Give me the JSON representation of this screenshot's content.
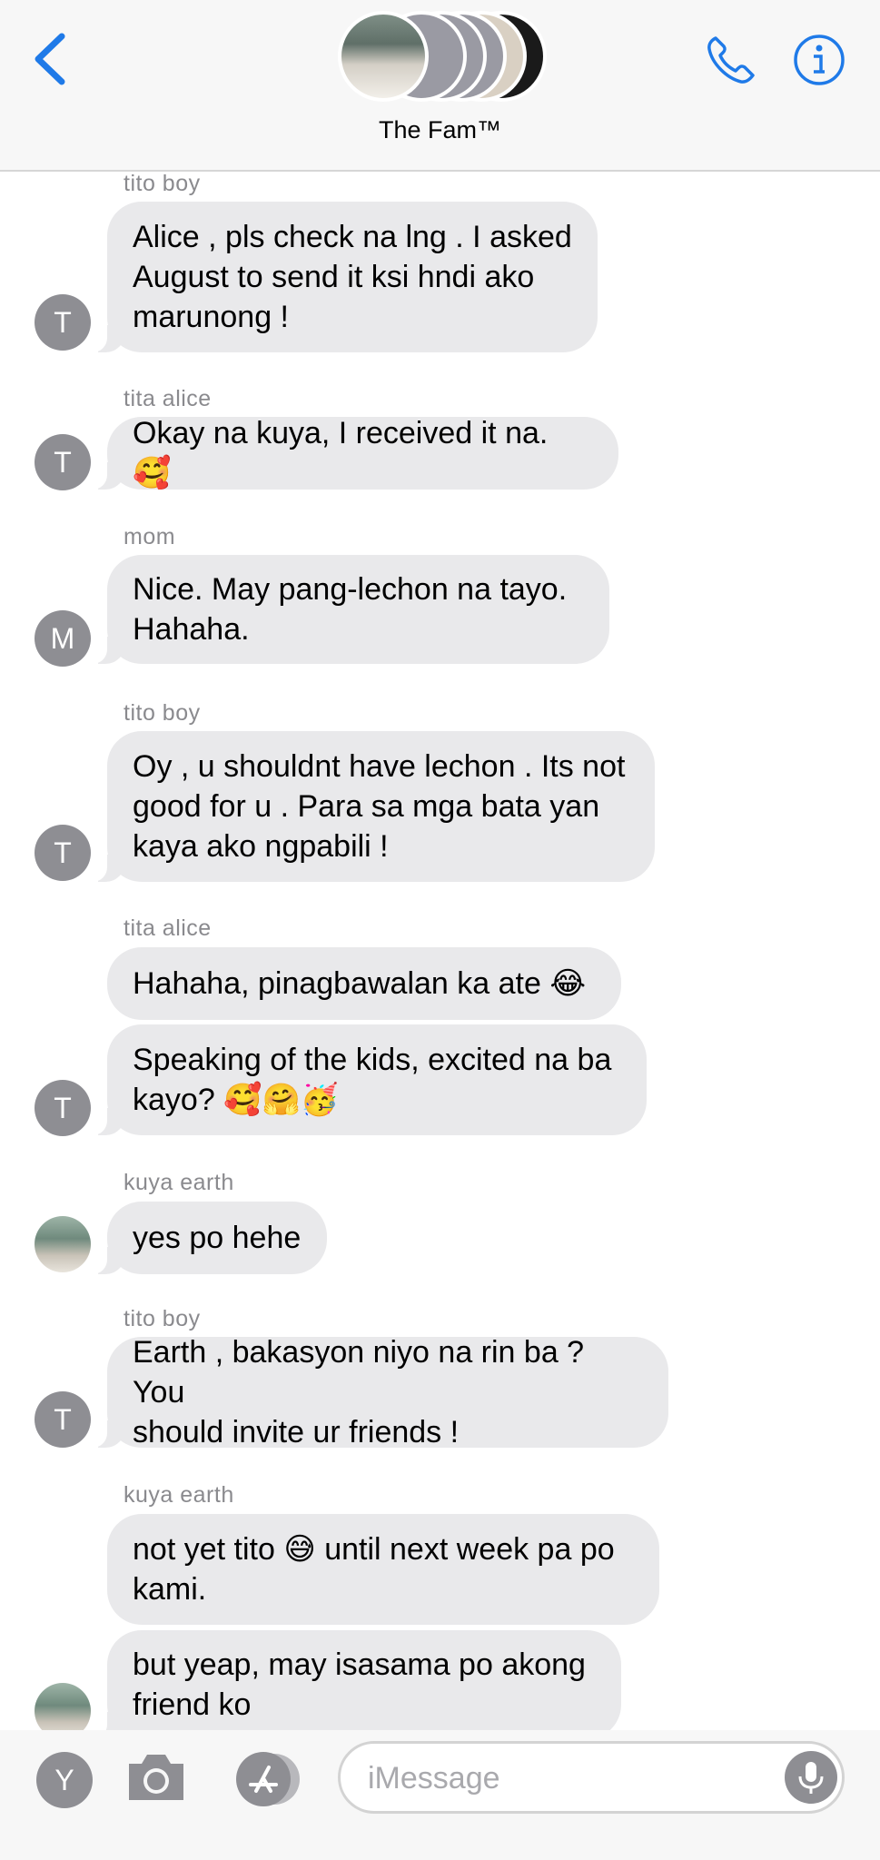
{
  "header": {
    "title": "The Fam™",
    "back_icon": "chevron-left-icon",
    "call_icon": "phone-icon",
    "info_icon": "info-icon",
    "accent_color": "#1f7ae8"
  },
  "messages": [
    {
      "sender": "tito boy",
      "text": "Alice , pls check na lng . I asked\nAugust to send it ksi hndi ako\nmarunong !",
      "avatar": "T"
    },
    {
      "sender": "tita alice",
      "text": "Okay na kuya, I received it na. 🥰",
      "avatar": "T"
    },
    {
      "sender": "mom",
      "text": "Nice. May pang-lechon na tayo.\nHahaha.",
      "avatar": "M"
    },
    {
      "sender": "tito boy",
      "text": "Oy , u shouldnt have lechon . Its not\ngood for u . Para sa mga bata yan\nkaya ako ngpabili !",
      "avatar": "T"
    },
    {
      "sender": "tita alice",
      "text": "Hahaha, pinagbawalan ka ate 😂"
    },
    {
      "text": "Speaking of the kids, excited na ba\nkayo? 🥰🤗🥳",
      "avatar": "T"
    },
    {
      "sender": "kuya earth",
      "text": "yes po hehe",
      "avatar": "photo"
    },
    {
      "sender": "tito boy",
      "text": "Earth , bakasyon niyo na rin ba ? You\nshould invite ur friends !",
      "avatar": "T"
    },
    {
      "sender": "kuya earth",
      "text": "not yet tito 😅 until next week pa po\nkami."
    },
    {
      "text": "but yeap, may isasama po akong\nfriend ko",
      "avatar": "photo"
    }
  ],
  "composer": {
    "user_initial": "Y",
    "camera_icon": "camera-icon",
    "apps_icon": "app-store-icon",
    "placeholder": "iMessage",
    "mic_icon": "microphone-icon"
  }
}
